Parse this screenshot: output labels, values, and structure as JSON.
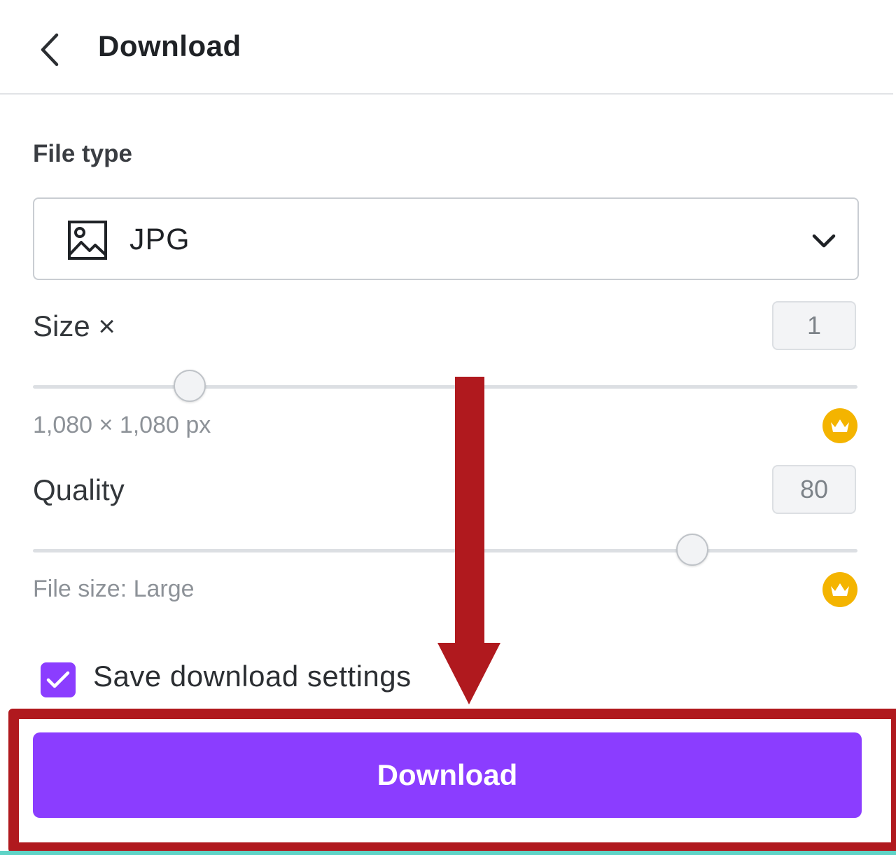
{
  "header": {
    "title": "Download",
    "back_icon": "chevron-left-icon"
  },
  "file_type": {
    "label": "File type",
    "selected": "JPG",
    "icon": "image-icon"
  },
  "size": {
    "label": "Size ×",
    "value": "1",
    "dimensions": "1,080 × 1,080 px",
    "slider_fraction": 0.19,
    "premium_icon": "crown-icon"
  },
  "quality": {
    "label": "Quality",
    "value": "80",
    "file_size": "File size: Large",
    "slider_fraction": 0.8,
    "premium_icon": "crown-icon"
  },
  "save_settings": {
    "label": "Save download settings",
    "checked": true
  },
  "download_button": {
    "label": "Download"
  },
  "colors": {
    "accent": "#8b3dff",
    "annotation": "#b0191e",
    "premium": "#f4b400"
  }
}
